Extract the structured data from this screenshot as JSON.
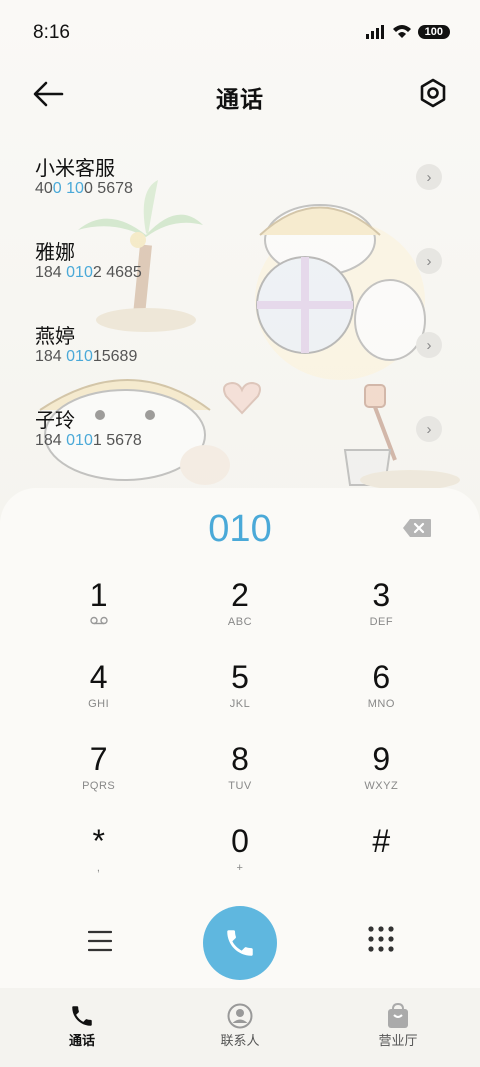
{
  "status": {
    "time": "8:16",
    "battery": "100"
  },
  "header": {
    "title": "通话"
  },
  "contacts": [
    {
      "name": "小米客服",
      "num_pre": "40",
      "num_hl1": "0",
      "num_mid": " ",
      "num_hl2": "10",
      "num_post": "0 5678"
    },
    {
      "name": "雅娜",
      "num_pre": "184 ",
      "num_hl1": "010",
      "num_mid": "",
      "num_hl2": "",
      "num_post": "2 4685"
    },
    {
      "name": "燕婷",
      "num_pre": "184 ",
      "num_hl1": "010",
      "num_mid": "",
      "num_hl2": "",
      "num_post": "15689"
    },
    {
      "name": "子玲",
      "num_pre": "184 ",
      "num_hl1": "010",
      "num_mid": "",
      "num_hl2": "",
      "num_post": "1 5678"
    }
  ],
  "dialer": {
    "input": "010",
    "keys": [
      {
        "digit": "1",
        "letters": ""
      },
      {
        "digit": "2",
        "letters": "ABC"
      },
      {
        "digit": "3",
        "letters": "DEF"
      },
      {
        "digit": "4",
        "letters": "GHI"
      },
      {
        "digit": "5",
        "letters": "JKL"
      },
      {
        "digit": "6",
        "letters": "MNO"
      },
      {
        "digit": "7",
        "letters": "PQRS"
      },
      {
        "digit": "8",
        "letters": "TUV"
      },
      {
        "digit": "9",
        "letters": "WXYZ"
      },
      {
        "digit": "*",
        "letters": ","
      },
      {
        "digit": "0",
        "letters": "+"
      },
      {
        "digit": "#",
        "letters": ""
      }
    ]
  },
  "tabs": [
    {
      "label": "通话",
      "icon": "phone-icon"
    },
    {
      "label": "联系人",
      "icon": "person-icon"
    },
    {
      "label": "营业厅",
      "icon": "shopping-bag-icon"
    }
  ],
  "colors": {
    "accent": "#4aa9d8",
    "call": "#5fb7df"
  }
}
